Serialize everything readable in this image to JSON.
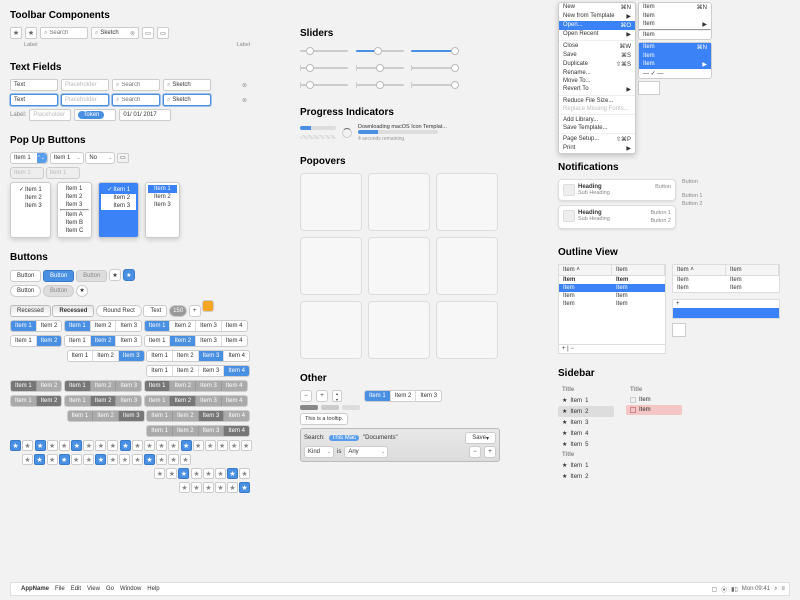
{
  "sections": {
    "toolbar": "Toolbar Components",
    "textfields": "Text Fields",
    "popup": "Pop Up Buttons",
    "buttons": "Buttons",
    "sliders": "Sliders",
    "progress": "Progress Indicators",
    "popovers": "Popovers",
    "other": "Other",
    "notifications": "Notifications",
    "outline": "Outline View",
    "sidebar": "Sidebar"
  },
  "toolbar": {
    "label": "Label",
    "search_ph": "Search",
    "sketch": "Sketch"
  },
  "textfields": {
    "text": "Text",
    "placeholder": "Placeholder",
    "search": "Search",
    "sketch": "Sketch",
    "label": "Label:",
    "token": "Token",
    "date": "01/ 01/ 2017"
  },
  "popup": {
    "item1": "Item 1",
    "item2": "Item 2",
    "item3": "Item 3",
    "itemA": "Item A",
    "itemB": "Item B",
    "itemC": "Item C",
    "no": "No"
  },
  "buttons": {
    "button": "Button",
    "recessed": "Recessed",
    "roundrect": "Round Rect",
    "text": "Text",
    "plus": "+",
    "item1": "Item 1",
    "item2": "Item 2",
    "item3": "Item 3",
    "item4": "Item 4"
  },
  "progress": {
    "downloading": "Downloading macOS Icon Templat...",
    "remaining": "4 seconds remaining"
  },
  "other": {
    "tooltip": "This is a tooltip.",
    "search_label": "Search:",
    "thismac": "This Mac",
    "documents": "\"Documents\"",
    "save": "Save",
    "kind": "Kind",
    "is": "is",
    "any": "Any",
    "item": "Item"
  },
  "ctx": {
    "new": "New",
    "newtpl": "New from Template",
    "open": "Open...",
    "openrecent": "Open Recent",
    "close": "Close",
    "save": "Save",
    "duplicate": "Duplicate",
    "rename": "Rename...",
    "moveto": "Move To...",
    "revert": "Revert To",
    "reduce": "Reduce File Size...",
    "replace": "Replace Missing Fonts...",
    "addlib": "Add Library...",
    "savetpl": "Save Template...",
    "pagesetup": "Page Setup...",
    "print": "Print",
    "kN": "⌘N",
    "kO": "⌘O",
    "kW": "⌘W",
    "kS": "⌘S",
    "kOS": "⇧⌘S",
    "kOP": "⇧⌘P",
    "arrow": "▶"
  },
  "sub": {
    "item": "Item",
    "kN": "⌘N",
    "sel": "⌘N",
    "check": "✓"
  },
  "notif": {
    "heading": "Heading",
    "subheading": "Sub Heading",
    "button": "Button",
    "b1": "Button 1",
    "b2": "Button 2"
  },
  "outline": {
    "item": "Item",
    "hdr_arrow": "˄"
  },
  "sidebar": {
    "title": "Title",
    "item": "Item"
  },
  "menubar": {
    "app": "AppName",
    "file": "File",
    "edit": "Edit",
    "view": "View",
    "go": "Go",
    "window": "Window",
    "help": "Help",
    "time": "Mon 09:41",
    "battery": "▮"
  },
  "colors": {
    "accent": "#4a90e2",
    "selection": "#3b82f6"
  }
}
